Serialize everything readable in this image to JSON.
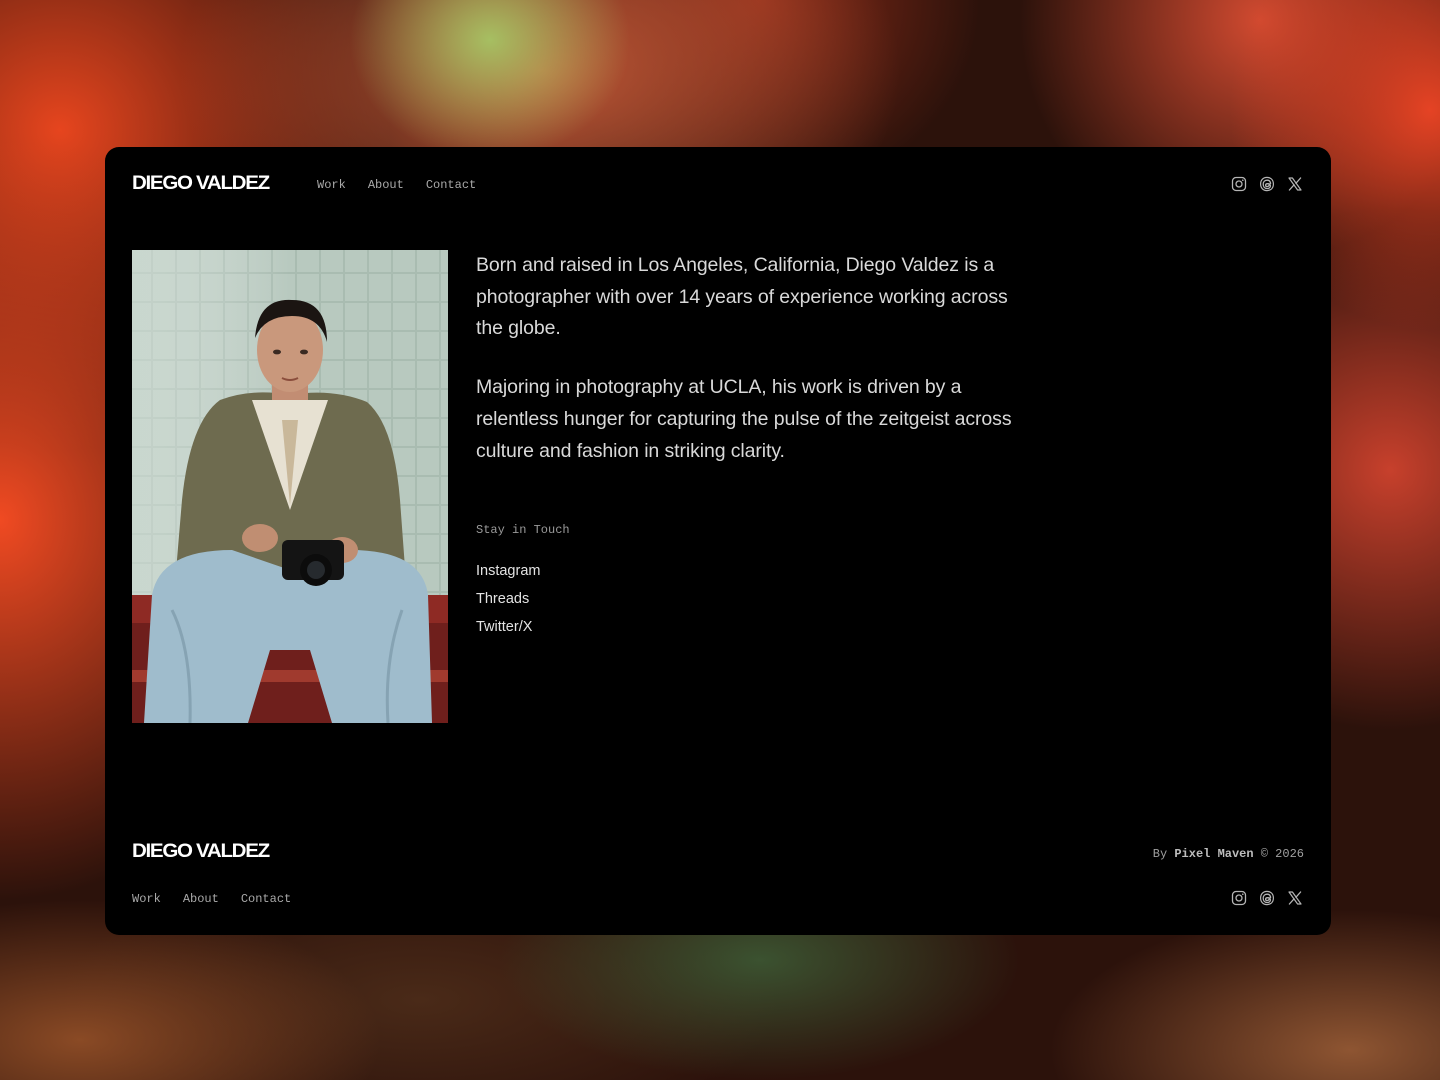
{
  "brand": {
    "name": "DIEGO VALDEZ"
  },
  "header": {
    "nav": [
      "Work",
      "About",
      "Contact"
    ],
    "social_icons": [
      "instagram-icon",
      "threads-icon",
      "x-icon"
    ]
  },
  "about": {
    "paragraphs": [
      "Born and raised in Los Angeles, California, Diego Valdez is a photographer with over 14 years of experience working across the globe.",
      "Majoring in photography at UCLA, his work is driven by a relentless hunger for capturing the pulse of the zeitgeist across culture and fashion in striking clarity."
    ],
    "portrait_icon": "portrait-photo"
  },
  "stay_in_touch": {
    "title": "Stay in Touch",
    "links": [
      "Instagram",
      "Threads",
      "Twitter/X"
    ]
  },
  "footer": {
    "brand": "DIEGO VALDEZ",
    "nav": [
      "Work",
      "About",
      "Contact"
    ],
    "credit": {
      "prefix": "By",
      "author": "Pixel Maven",
      "copyright": "© 2026"
    },
    "social_icons": [
      "instagram-icon",
      "threads-icon",
      "x-icon"
    ]
  },
  "colors": {
    "card_bg": "#000000",
    "text_primary": "#d9d9d9",
    "text_muted": "#a9a9a9",
    "background_accent": "#f04a22"
  }
}
